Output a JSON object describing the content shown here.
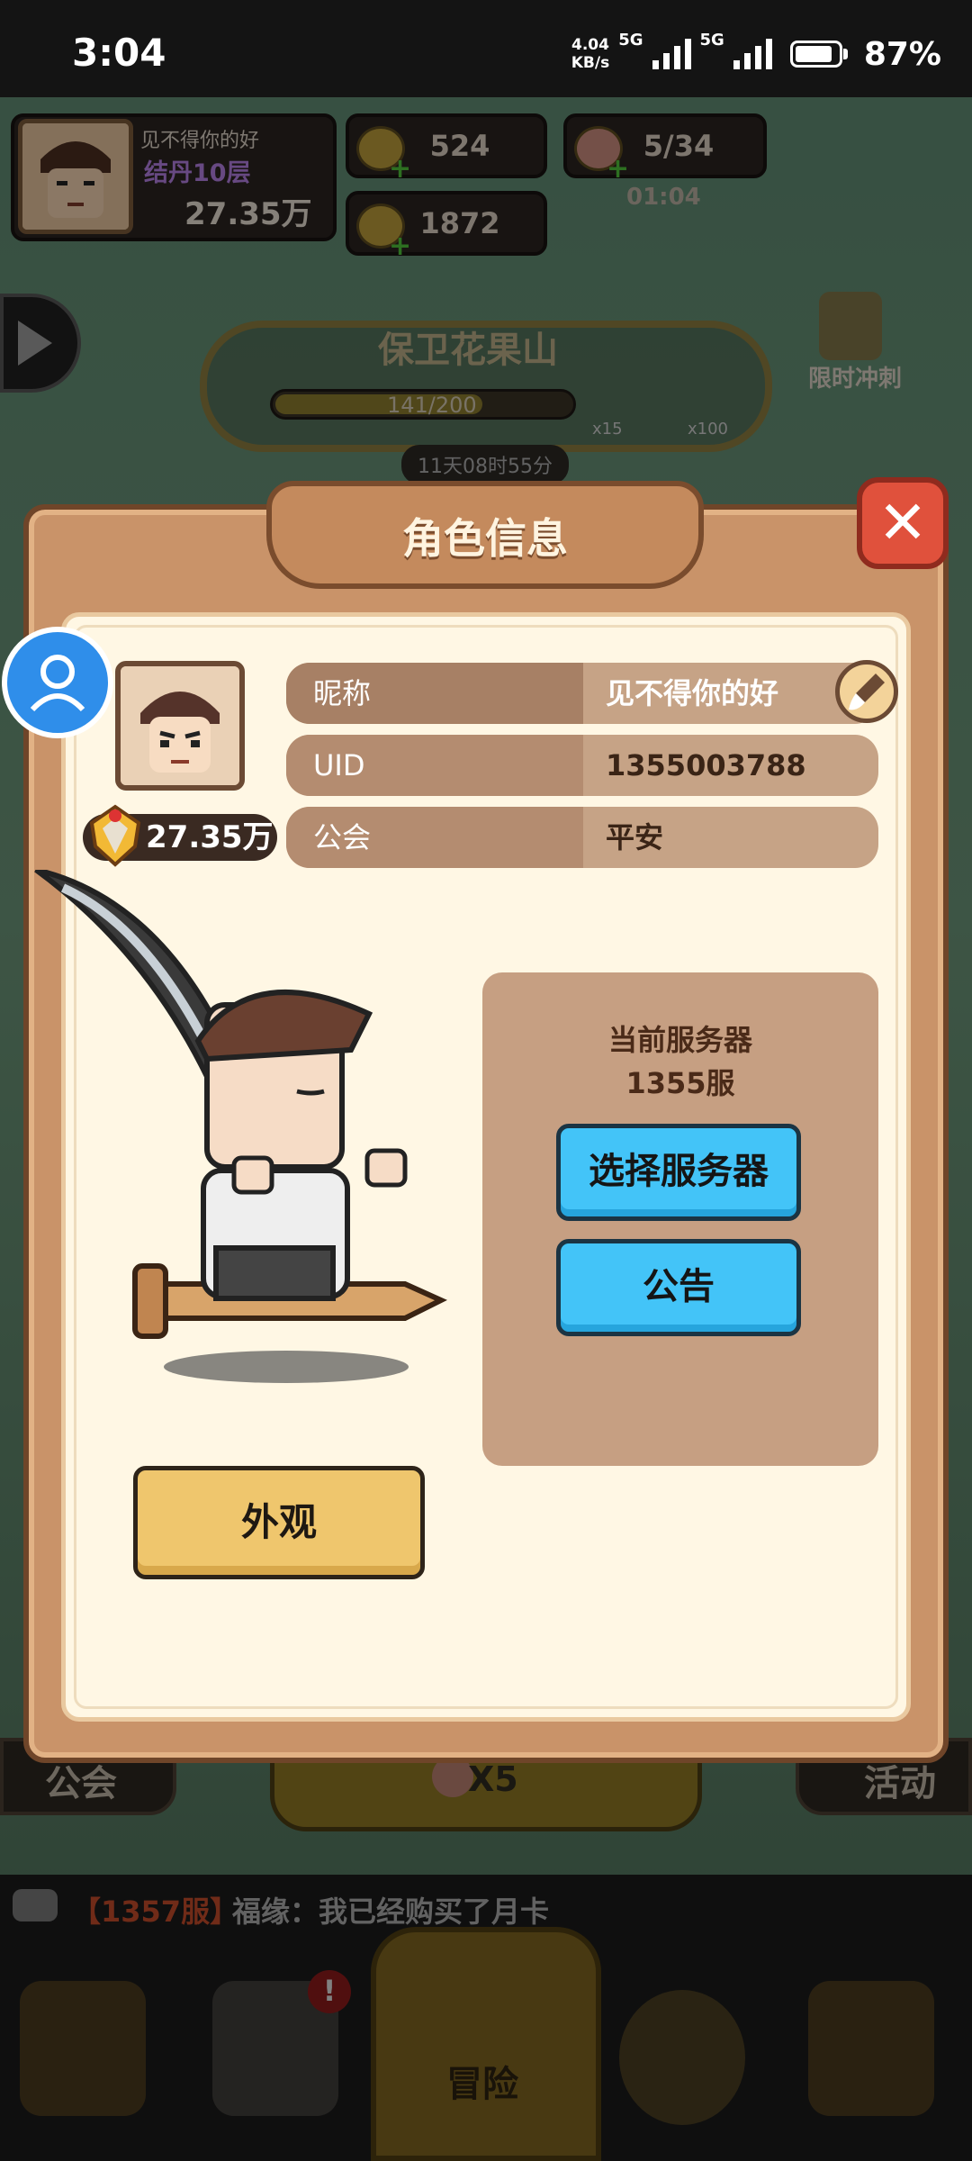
{
  "status_bar": {
    "time": "3:04",
    "net_speed_value": "4.04",
    "net_speed_unit": "KB/s",
    "network_1": "5G",
    "network_2": "5G",
    "battery": "87%"
  },
  "hud": {
    "player_name": "见不得你的好",
    "player_rank": "结丹10层",
    "player_power": "27.35万",
    "gold": "524",
    "coins": "1872",
    "peach_stamina": "5/34",
    "stamina_timer": "01:04"
  },
  "event": {
    "title": "保卫花果山",
    "progress_text": "141/200",
    "progress_value": 0.705,
    "reward_1": "x15",
    "reward_2": "x100",
    "countdown": "11天08时55分",
    "limited_label": "限时冲刺"
  },
  "modal": {
    "title": "角色信息",
    "power": "27.35万",
    "fields": [
      {
        "label": "昵称",
        "value": "见不得你的好"
      },
      {
        "label": "UID",
        "value": "1355003788"
      },
      {
        "label": "公会",
        "value": "平安"
      }
    ],
    "server": {
      "title": "当前服务器",
      "name": "1355服",
      "select_button": "选择服务器",
      "notice_button": "公告"
    },
    "skin_button": "外观"
  },
  "bottom": {
    "guild_label": "公会",
    "activity_label": "活动",
    "peach_cost": "X5",
    "chat_server": "【1357服】",
    "chat_message": "福缘：我已经购买了月卡",
    "nav_adventure": "冒险",
    "badge": "!"
  },
  "colors": {
    "modal_bg": "#c99369",
    "panel_bg": "#fff7e4",
    "blue_button": "#43c4f8",
    "gold_button": "#efc66d",
    "close_button": "#e0513c"
  }
}
